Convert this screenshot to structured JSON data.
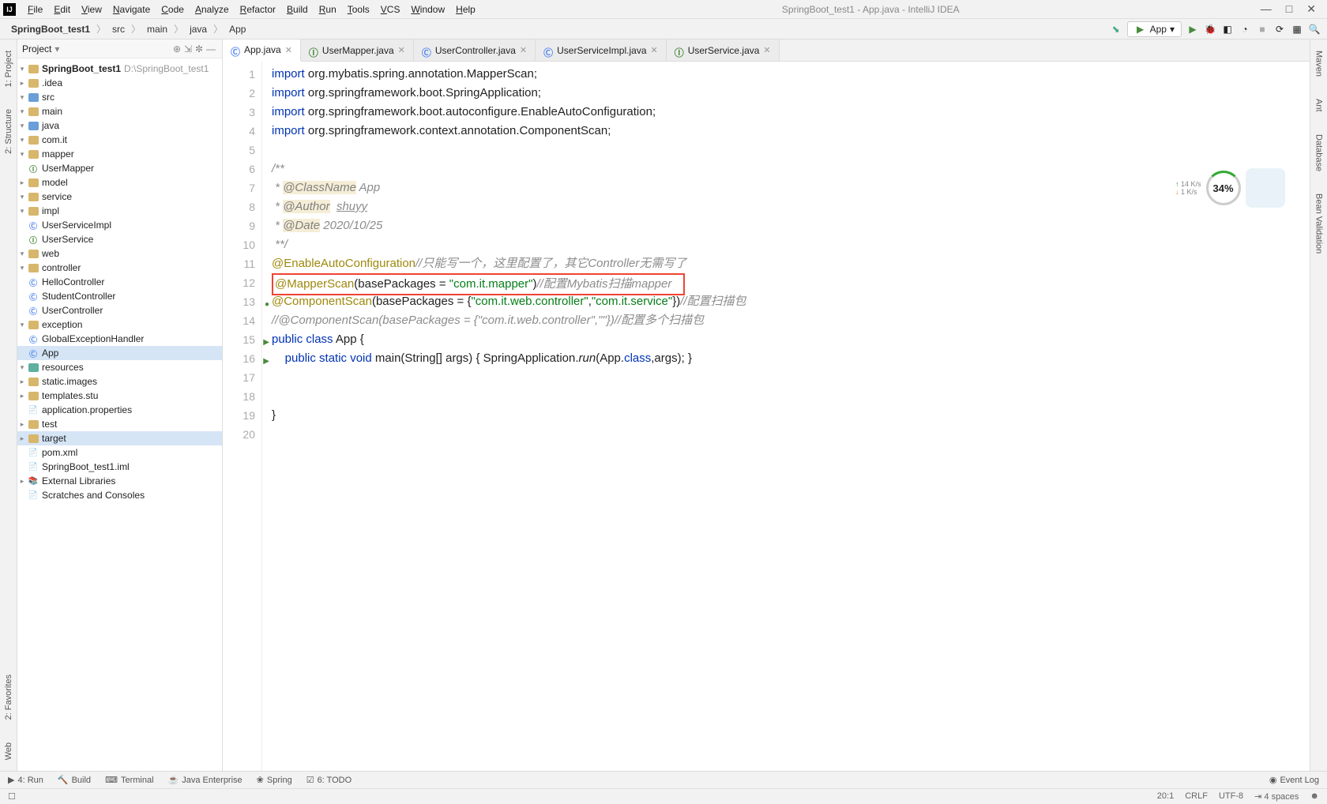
{
  "app": {
    "title": "SpringBoot_test1 - App.java - IntelliJ IDEA"
  },
  "menus": [
    "File",
    "Edit",
    "View",
    "Navigate",
    "Code",
    "Analyze",
    "Refactor",
    "Build",
    "Run",
    "Tools",
    "VCS",
    "Window",
    "Help"
  ],
  "breadcrumb": [
    "SpringBoot_test1",
    "src",
    "main",
    "java",
    "App"
  ],
  "runConfig": "App",
  "projectPanel": {
    "title": "Project",
    "root": {
      "name": "SpringBoot_test1",
      "path": "D:\\SpringBoot_test1"
    },
    "tree": [
      {
        "d": 1,
        "t": "dir",
        "n": ".idea",
        "exp": "▸"
      },
      {
        "d": 1,
        "t": "dir",
        "n": "src",
        "exp": "▾",
        "cls": "blue"
      },
      {
        "d": 2,
        "t": "dir",
        "n": "main",
        "exp": "▾"
      },
      {
        "d": 3,
        "t": "dir",
        "n": "java",
        "exp": "▾",
        "cls": "blue"
      },
      {
        "d": 4,
        "t": "dir",
        "n": "com.it",
        "exp": "▾"
      },
      {
        "d": 5,
        "t": "dir",
        "n": "mapper",
        "exp": "▾"
      },
      {
        "d": 6,
        "t": "int",
        "n": "UserMapper"
      },
      {
        "d": 5,
        "t": "dir",
        "n": "model",
        "exp": "▸"
      },
      {
        "d": 5,
        "t": "dir",
        "n": "service",
        "exp": "▾"
      },
      {
        "d": 6,
        "t": "dir",
        "n": "impl",
        "exp": "▾"
      },
      {
        "d": 7,
        "t": "cls",
        "n": "UserServiceImpl"
      },
      {
        "d": 6,
        "t": "int",
        "n": "UserService"
      },
      {
        "d": 5,
        "t": "dir",
        "n": "web",
        "exp": "▾"
      },
      {
        "d": 6,
        "t": "dir",
        "n": "controller",
        "exp": "▾"
      },
      {
        "d": 7,
        "t": "cls",
        "n": "HelloController"
      },
      {
        "d": 7,
        "t": "cls",
        "n": "StudentController"
      },
      {
        "d": 7,
        "t": "cls",
        "n": "UserController"
      },
      {
        "d": 6,
        "t": "dir",
        "n": "exception",
        "exp": "▾"
      },
      {
        "d": 7,
        "t": "cls",
        "n": "GlobalExceptionHandler"
      },
      {
        "d": 4,
        "t": "cls",
        "n": "App",
        "sel": true
      },
      {
        "d": 3,
        "t": "dir",
        "n": "resources",
        "exp": "▾",
        "cls": "teal"
      },
      {
        "d": 4,
        "t": "dir",
        "n": "static.images",
        "exp": "▸"
      },
      {
        "d": 4,
        "t": "dir",
        "n": "templates.stu",
        "exp": "▸"
      },
      {
        "d": 4,
        "t": "file",
        "n": "application.properties"
      },
      {
        "d": 2,
        "t": "dir",
        "n": "test",
        "exp": "▸"
      },
      {
        "d": 1,
        "t": "dir",
        "n": "target",
        "exp": "▸",
        "sel": true,
        "cls": "orange"
      },
      {
        "d": 1,
        "t": "file",
        "n": "pom.xml",
        "ico": "m"
      },
      {
        "d": 1,
        "t": "file",
        "n": "SpringBoot_test1.iml"
      }
    ],
    "extra": [
      "External Libraries",
      "Scratches and Consoles"
    ]
  },
  "tabs": [
    {
      "label": "App.java",
      "active": true,
      "ico": "c"
    },
    {
      "label": "UserMapper.java",
      "ico": "i"
    },
    {
      "label": "UserController.java",
      "ico": "c"
    },
    {
      "label": "UserServiceImpl.java",
      "ico": "c"
    },
    {
      "label": "UserService.java",
      "ico": "i"
    }
  ],
  "code": {
    "lines": [
      {
        "n": 1,
        "html": "<span class='kw'>import</span> org.mybatis.spring.annotation.MapperScan;"
      },
      {
        "n": 2,
        "html": "<span class='kw'>import</span> org.springframework.boot.SpringApplication;"
      },
      {
        "n": 3,
        "html": "<span class='kw'>import</span> org.springframework.boot.autoconfigure.EnableAutoConfiguration;"
      },
      {
        "n": 4,
        "html": "<span class='kw'>import</span> org.springframework.context.annotation.ComponentScan;"
      },
      {
        "n": 5,
        "html": ""
      },
      {
        "n": 6,
        "html": "<span class='cmt'>/**</span>"
      },
      {
        "n": 7,
        "html": "<span class='cmt'> * </span><span class='ital-tag'>@ClassName</span><span class='cmt'> App</span>"
      },
      {
        "n": 8,
        "html": "<span class='cmt'> * </span><span class='ital-tag'>@Author</span><span class='cmt'>  <u>shuyy</u></span>"
      },
      {
        "n": 9,
        "html": "<span class='cmt'> * </span><span class='ital-tag'>@Date</span><span class='cmt'> 2020/10/25</span>"
      },
      {
        "n": 10,
        "html": "<span class='cmt'> **/</span>"
      },
      {
        "n": 11,
        "html": "<span class='ann'>@EnableAutoConfiguration</span><span class='cmt'>//只能写一个，这里配置了，其它Controller无需写了</span>"
      },
      {
        "n": 12,
        "html": "<span class='redbox'><span class='ann'>@MapperScan</span>(basePackages = <span class='str'>\"com.it.mapper\"</span>)<span class='cmt'>//配置Mybatis扫描mapper</span>   </span>"
      },
      {
        "n": 13,
        "html": "<span class='ann'>@ComponentScan</span>(basePackages = {<span class='str'>\"com.it.web.controller\"</span>,<span class='str'>\"com.it.service\"</span>})<span class='cmt'>//配置扫描包</span>"
      },
      {
        "n": 14,
        "html": "<span class='cmt'>//@ComponentScan(basePackages = {\"com.it.web.controller\",\"\"})//配置多个扫描包</span>"
      },
      {
        "n": 15,
        "html": "<span class='kw'>public class</span> App {"
      },
      {
        "n": 16,
        "html": "    <span class='kw'>public static void</span> main(String[] args) { SpringApplication.<i>run</i>(App.<span class='kw'>class</span>,args); }"
      },
      {
        "n": 17,
        "html": ""
      },
      {
        "n": 18,
        "html": ""
      },
      {
        "n": 19,
        "html": "}"
      },
      {
        "n": 20,
        "html": ""
      }
    ],
    "gutterMarks": {
      "13": "●",
      "15": "▶",
      "16": "▶"
    }
  },
  "widget": {
    "percent": "34%",
    "up": "14 K/s",
    "down": "1 K/s"
  },
  "leftStrip": [
    "1: Project",
    "2: Structure",
    "2: Favorites",
    "Web"
  ],
  "rightStrip": [
    "Maven",
    "Ant",
    "Database",
    "Bean Validation"
  ],
  "bottomTools": [
    "4: Run",
    "Build",
    "Terminal",
    "Java Enterprise",
    "Spring",
    "6: TODO"
  ],
  "bottomRight": "Event Log",
  "status": {
    "pos": "20:1",
    "eol": "CRLF",
    "enc": "UTF-8",
    "indent": "4 spaces"
  }
}
